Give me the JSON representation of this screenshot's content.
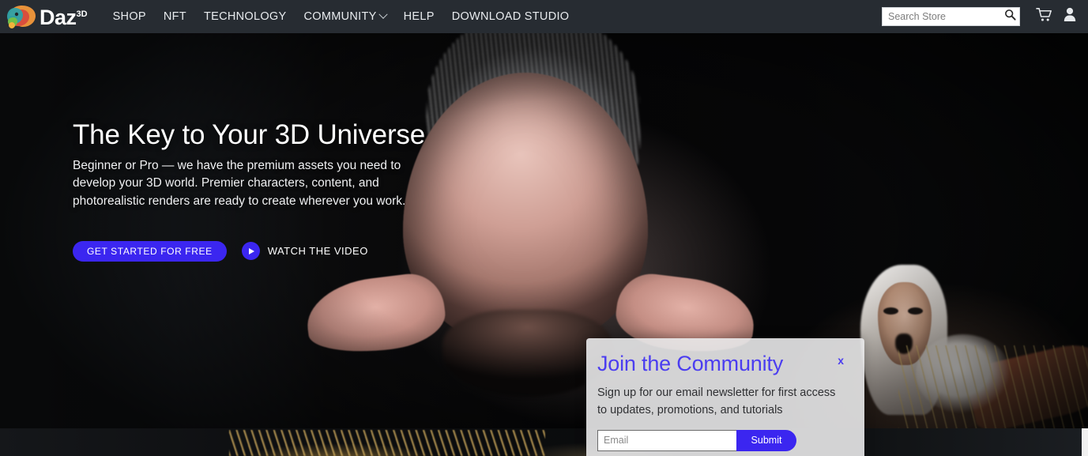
{
  "navbar": {
    "logo": {
      "name": "Daz",
      "superscript": "3D"
    },
    "links": [
      {
        "label": "SHOP",
        "has_dropdown": false
      },
      {
        "label": "NFT",
        "has_dropdown": false
      },
      {
        "label": "TECHNOLOGY",
        "has_dropdown": false
      },
      {
        "label": "COMMUNITY",
        "has_dropdown": true
      },
      {
        "label": "HELP",
        "has_dropdown": false
      },
      {
        "label": "DOWNLOAD STUDIO",
        "has_dropdown": false
      }
    ],
    "search": {
      "placeholder": "Search Store",
      "value": "",
      "icon": "search-icon"
    },
    "cart_icon": "shopping-cart-icon",
    "account_icon": "user-account-icon"
  },
  "hero": {
    "title": "The Key to Your 3D Universe",
    "subtitle": "Beginner or Pro — we have the premium assets you need to develop your 3D world. Premier characters, content, and photorealistic renders are ready to create wherever you work.",
    "primary_button": "GET STARTED FOR FREE",
    "video_link": "WATCH THE VIDEO",
    "play_icon": "play-icon"
  },
  "popup": {
    "title": "Join the Community",
    "body": "Sign up for our email newsletter for first access to updates, promotions, and tutorials",
    "email_placeholder": "Email",
    "email_value": "",
    "submit_label": "Submit",
    "close_label": "x"
  },
  "colors": {
    "navbar_bg": "#272c32",
    "accent": "#3b26f0",
    "popup_title": "#4b3df0",
    "hero_bg": "#0a0a0b",
    "popup_bg": "#e9e9ea"
  }
}
